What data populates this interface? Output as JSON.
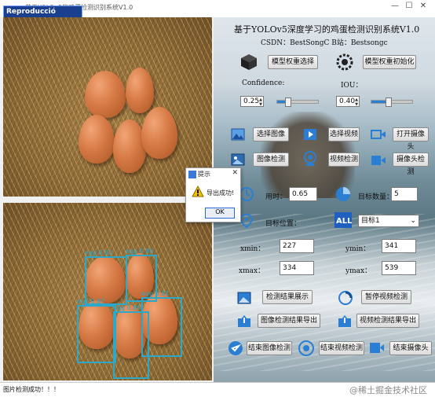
{
  "window": {
    "title": "基于YOLOv5的鸡蛋检测识别系统V1.0",
    "recording_badge": "Reproducció pausada",
    "controls": [
      "—",
      "☐",
      "✕"
    ]
  },
  "images": {
    "original_alt": "source image",
    "detections": [
      {
        "label": "egg",
        "score": "0.82"
      },
      {
        "label": "egg",
        "score": "0.86"
      },
      {
        "label": "egg",
        "score": "0.87"
      },
      {
        "label": "egg",
        "score": "0.86"
      },
      {
        "label": "egg",
        "score": "0.81"
      }
    ]
  },
  "panel": {
    "title": "基于YOLOv5深度学习的鸡蛋检测识别系统V1.0",
    "credits": "CSDN：BestSongC   B站：Bestsongc",
    "select_weights": "模型权重选择",
    "init_model": "模型权重初始化",
    "confidence_label": "Confidence:",
    "confidence_value": "0.25",
    "confidence_fraction": 0.25,
    "iou_label": "IOU：",
    "iou_value": "0.40",
    "iou_fraction": 0.4,
    "select_image": "选择图像",
    "select_video": "选择视频",
    "open_camera": "打开摄像头",
    "image_detect": "图像检测",
    "video_detect": "视频检测",
    "camera_detect": "摄像头检测",
    "time_label": "用时：",
    "time_value": "0.65",
    "target_count_label": "目标数量：",
    "target_count_value": "5",
    "target_pos_label": "目标位置：",
    "target_select": "目标1",
    "xmin_label": "xmin：",
    "xmin_value": "227",
    "ymin_label": "ymin：",
    "ymin_value": "341",
    "xmax_label": "xmax：",
    "xmax_value": "334",
    "ymax_label": "ymax：",
    "ymax_value": "539",
    "show_results": "检测结果展示",
    "pause_video": "暂停视频检测",
    "export_image": "图像检测结果导出",
    "export_video": "视频检测结果导出",
    "end_image": "结束图像检测",
    "end_video": "结束视频检测",
    "end_camera": "结束摄像头"
  },
  "dialog": {
    "title": "提示",
    "message": "导出成功!",
    "ok": "OK"
  },
  "status": {
    "text": "图片检测成功！！！",
    "watermark": "@稀土掘金技术社区"
  },
  "colors": {
    "accent": "#2a7fd4",
    "detection_box": "#2ca8c9"
  }
}
